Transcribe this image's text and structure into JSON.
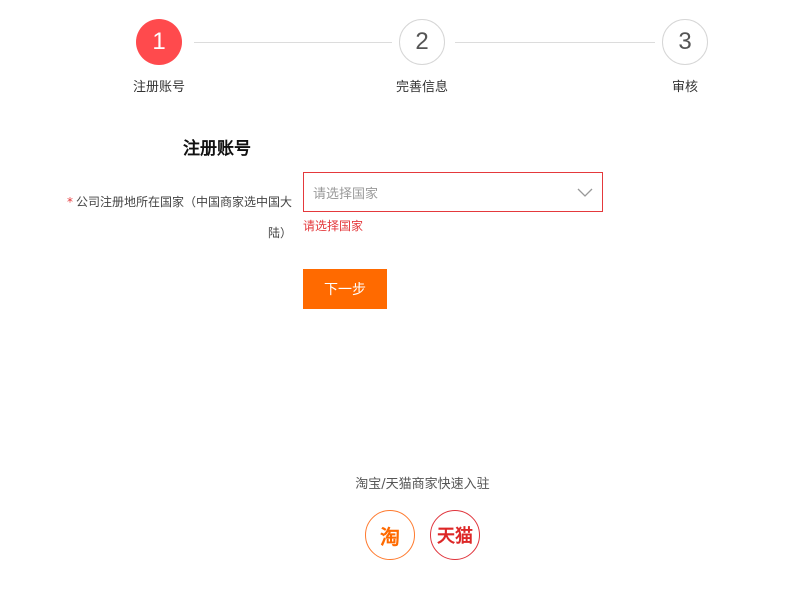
{
  "steps": [
    {
      "number": "1",
      "label": "注册账号",
      "state": "active"
    },
    {
      "number": "2",
      "label": "完善信息",
      "state": "idle"
    },
    {
      "number": "3",
      "label": "审核",
      "state": "idle"
    }
  ],
  "form": {
    "title": "注册账号",
    "required_mark": "*",
    "country_label_line1": "公司注册地所在国家（中国商家选中国大",
    "country_label_line2": "陆）",
    "country_select_placeholder": "请选择国家",
    "country_error": "请选择国家",
    "next_button": "下一步"
  },
  "quick_entry": {
    "title": "淘宝/天猫商家快速入驻",
    "taobao_text": "淘",
    "tmall_text": "天猫"
  },
  "colors": {
    "active_step": "#ff4a4d",
    "error": "#e4393c",
    "primary_button": "#ff6a00",
    "taobao": "#ff6a00",
    "tmall": "#dd2727"
  }
}
